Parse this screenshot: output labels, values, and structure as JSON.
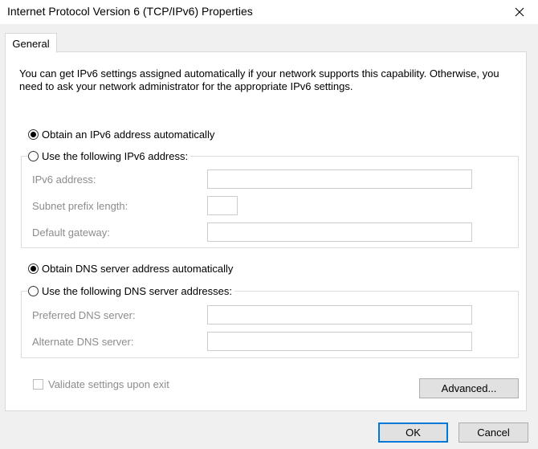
{
  "window": {
    "title": "Internet Protocol Version 6 (TCP/IPv6) Properties",
    "close_icon": "close-icon"
  },
  "tabs": [
    {
      "label": "General",
      "active": true
    }
  ],
  "general": {
    "description": "You can get IPv6 settings assigned automatically if your network supports this capability. Otherwise, you need to ask your network administrator for the appropriate IPv6 settings.",
    "ip": {
      "auto_label": "Obtain an IPv6 address automatically",
      "auto_checked": true,
      "manual_label": "Use the following IPv6 address:",
      "manual_checked": false,
      "fields": {
        "ipv6_address_label": "IPv6 address:",
        "ipv6_address_value": "",
        "subnet_prefix_label": "Subnet prefix length:",
        "subnet_prefix_value": "",
        "default_gateway_label": "Default gateway:",
        "default_gateway_value": ""
      }
    },
    "dns": {
      "auto_label": "Obtain DNS server address automatically",
      "auto_checked": true,
      "manual_label": "Use the following DNS server addresses:",
      "manual_checked": false,
      "fields": {
        "preferred_label": "Preferred DNS server:",
        "preferred_value": "",
        "alternate_label": "Alternate DNS server:",
        "alternate_value": ""
      }
    },
    "validate_label": "Validate settings upon exit",
    "validate_checked": false,
    "advanced_label": "Advanced..."
  },
  "footer": {
    "ok_label": "OK",
    "cancel_label": "Cancel"
  },
  "colors": {
    "disabled_text": "#8c8c8c",
    "default_button_border": "#0078d7"
  }
}
